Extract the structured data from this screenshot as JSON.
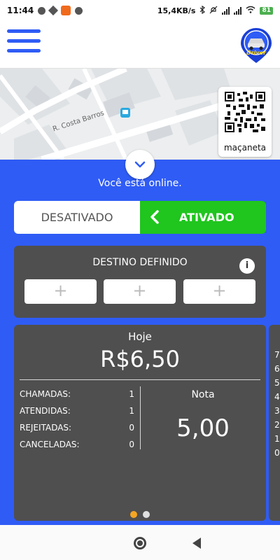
{
  "status_bar": {
    "time": "11:44",
    "network_speed": "15,4KB/s",
    "battery": "81"
  },
  "app_header": {
    "menu_icon": "hamburger-menu-icon",
    "logo_icon": "driver-logo-icon",
    "logo_text": "Driver"
  },
  "map": {
    "street_label": "R. Costa Barros",
    "qr_label": "maçaneta"
  },
  "status_text": "Você está online.",
  "toggle": {
    "off_label": "DESATIVADO",
    "on_label": "ATIVADO",
    "active": "on"
  },
  "destination": {
    "title": "DESTINO DEFINIDO",
    "info_icon": "i",
    "slots": [
      "+",
      "+",
      "+"
    ]
  },
  "stats": {
    "period": "Hoje",
    "amount": "R$6,50",
    "rows": [
      {
        "label": "CHAMADAS:",
        "value": "1"
      },
      {
        "label": "ATENDIDAS:",
        "value": "1"
      },
      {
        "label": "REJEITADAS:",
        "value": "0"
      },
      {
        "label": "CANCELADAS:",
        "value": "0"
      }
    ],
    "rating_label": "Nota",
    "rating_value": "5,00"
  },
  "next_card_values": [
    "7,",
    "6,",
    "5,",
    "4,",
    "3,",
    "2,",
    "1,",
    "0,"
  ],
  "pager": {
    "count": 2,
    "active_index": 0
  },
  "colors": {
    "primary_blue": "#2f5cf5",
    "active_green": "#20c51e",
    "card_gray": "#4f4f4f",
    "pager_active": "#f5a623",
    "pager_inactive": "#e0e0e0"
  }
}
